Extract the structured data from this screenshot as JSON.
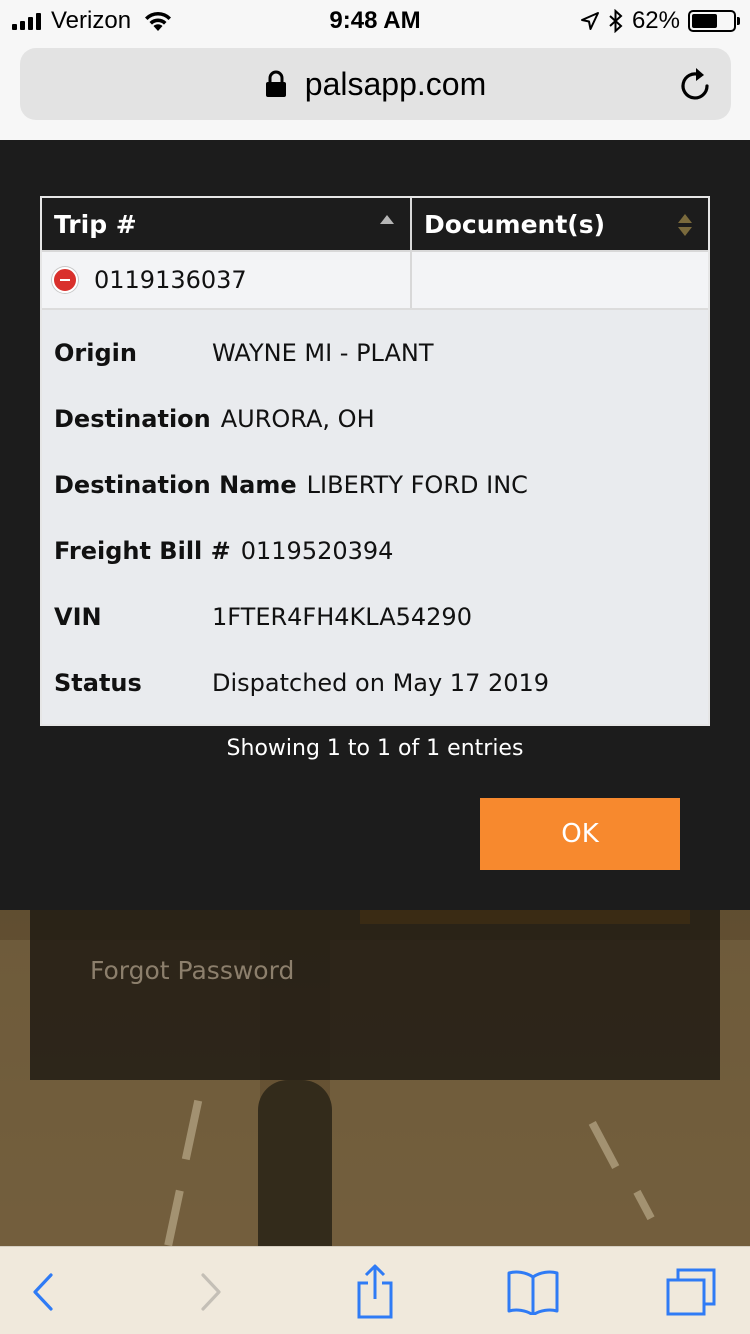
{
  "status_bar": {
    "carrier": "Verizon",
    "time": "9:48 AM",
    "battery_percent": "62%",
    "battery_level": 0.62,
    "icons": [
      "signal-icon",
      "wifi-icon",
      "location-icon",
      "bluetooth-icon",
      "battery-icon"
    ]
  },
  "browser": {
    "url": "palsapp.com",
    "icons": [
      "lock-icon",
      "reload-icon"
    ]
  },
  "modal": {
    "table": {
      "columns": [
        "Trip #",
        "Document(s)"
      ],
      "row": {
        "trip_number": "0119136037",
        "documents": ""
      },
      "details": [
        {
          "label": "Origin",
          "value": "WAYNE MI - PLANT"
        },
        {
          "label": "Destination",
          "value": "AURORA, OH"
        },
        {
          "label": "Destination Name",
          "value": "LIBERTY FORD INC"
        },
        {
          "label": "Freight Bill #",
          "value": "0119520394"
        },
        {
          "label": "VIN",
          "value": "1FTER4FH4KLA54290"
        },
        {
          "label": "Status",
          "value": "Dispatched on May 17 2019"
        }
      ]
    },
    "info": "Showing 1 to 1 of 1 entries",
    "ok_label": "OK",
    "colors": {
      "accent": "#f7892e",
      "modal_bg": "#1c1c1c"
    }
  },
  "background_page": {
    "forgot_password": "Forgot Password"
  },
  "toolbar": {
    "icons": [
      "back-icon",
      "forward-icon",
      "share-icon",
      "bookmarks-icon",
      "tabs-icon"
    ]
  }
}
